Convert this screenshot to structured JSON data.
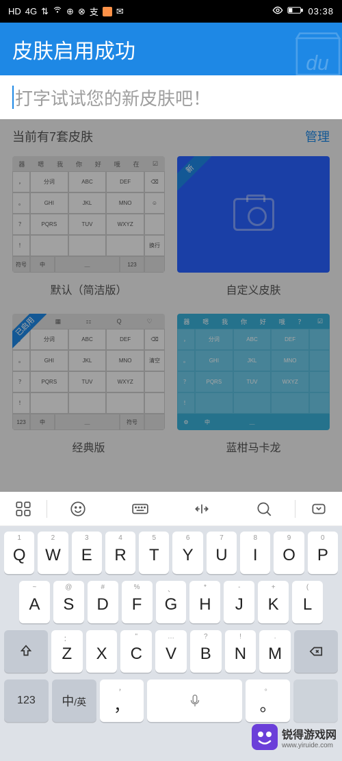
{
  "status": {
    "left_icons": [
      "HD",
      "4G",
      "⇅",
      "wifi",
      "⊕",
      "⊘",
      "支",
      "⬛",
      "✉"
    ],
    "right_icons": [
      "👁",
      "🔋"
    ],
    "time": "03:38"
  },
  "header": {
    "title": "皮肤启用成功",
    "logo_text": "du"
  },
  "input": {
    "placeholder": "打字试试您的新皮肤吧！"
  },
  "dimmed": {
    "count_label": "当前有7套皮肤",
    "manage": "管理",
    "skins": [
      {
        "label": "默认（简洁版）",
        "ribbon": ""
      },
      {
        "label": "自定义皮肤",
        "ribbon": "新"
      },
      {
        "label": "经典版",
        "ribbon": "已启用"
      },
      {
        "label": "蓝柑马卡龙",
        "ribbon": ""
      }
    ],
    "kb_preview": {
      "top": [
        "器",
        "嗯",
        "我",
        "你",
        "好",
        "哦",
        "在",
        "☑"
      ],
      "cells": [
        [
          "，",
          "分词",
          "ABC",
          "DEF",
          "⌫"
        ],
        [
          "。",
          "GHI",
          "JKL",
          "MNO",
          "☺"
        ],
        [
          "？",
          "PQRS",
          "TUV",
          "WXYZ",
          ""
        ],
        [
          "！",
          "",
          "",
          "",
          "换行"
        ]
      ],
      "bottom": [
        "符号",
        "中",
        "＿",
        "123",
        ""
      ]
    },
    "kb_classic_extra": "清空"
  },
  "keyboard": {
    "toolbar_icons": [
      "grid",
      "smile",
      "keyboard",
      "cursor",
      "search",
      "chevron-down"
    ],
    "row1": [
      {
        "sup": "1",
        "main": "Q"
      },
      {
        "sup": "2",
        "main": "W"
      },
      {
        "sup": "3",
        "main": "E"
      },
      {
        "sup": "4",
        "main": "R"
      },
      {
        "sup": "5",
        "main": "T"
      },
      {
        "sup": "6",
        "main": "Y"
      },
      {
        "sup": "7",
        "main": "U"
      },
      {
        "sup": "8",
        "main": "I"
      },
      {
        "sup": "9",
        "main": "O"
      },
      {
        "sup": "0",
        "main": "P"
      }
    ],
    "row2": [
      {
        "sup": "~",
        "main": "A"
      },
      {
        "sup": "@",
        "main": "S"
      },
      {
        "sup": "#",
        "main": "D"
      },
      {
        "sup": "%",
        "main": "F"
      },
      {
        "sup": "、",
        "main": "G"
      },
      {
        "sup": "*",
        "main": "H"
      },
      {
        "sup": "-",
        "main": "J"
      },
      {
        "sup": "+",
        "main": "K"
      },
      {
        "sup": "(",
        "main": "L"
      }
    ],
    "row3": [
      {
        "sup": "：",
        "main": "Z"
      },
      {
        "sup": "",
        "main": "X"
      },
      {
        "sup": "\"",
        "main": "C"
      },
      {
        "sup": "…",
        "main": "V"
      },
      {
        "sup": "?",
        "main": "B"
      },
      {
        "sup": "!",
        "main": "N"
      },
      {
        "sup": ".",
        "main": "M"
      }
    ],
    "row4": {
      "k123": "123",
      "lang": "中/英",
      "comma_sup": "，",
      "comma": "，",
      "period": "。",
      "period_sup": "。"
    }
  },
  "watermark": {
    "name": "锐得游戏网",
    "url": "www.yiruide.com"
  }
}
